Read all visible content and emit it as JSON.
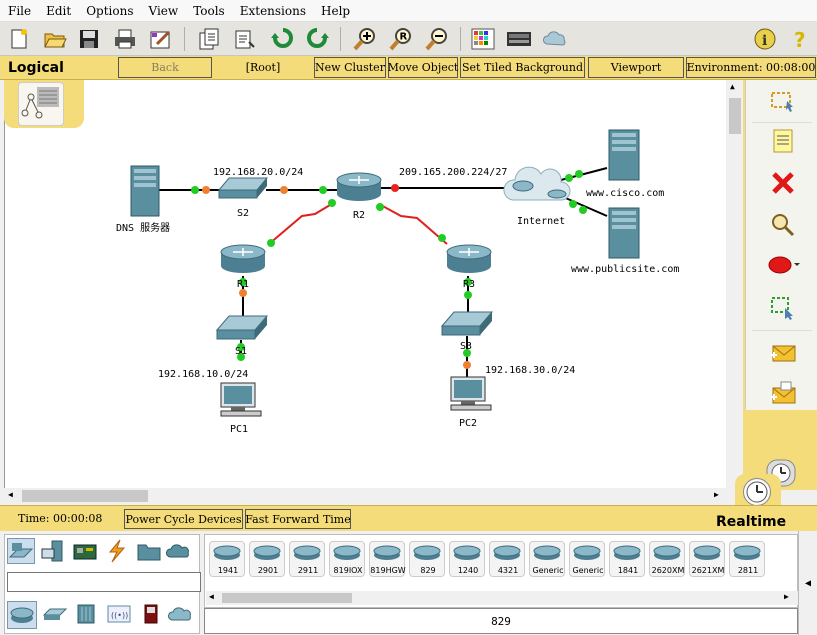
{
  "menu": [
    "File",
    "Edit",
    "Options",
    "View",
    "Tools",
    "Extensions",
    "Help"
  ],
  "navbar": {
    "title": "Logical",
    "back": "Back",
    "root": "[Root]",
    "new_cluster": "New Cluster",
    "move_object": "Move Object",
    "set_tiled_background": "Set Tiled Background",
    "viewport": "Viewport",
    "environment": "Environment: 00:08:00"
  },
  "topology": {
    "networks": {
      "lan20": "192.168.20.0/24",
      "wan": "209.165.200.224/27",
      "lan10": "192.168.10.0/24",
      "lan30": "192.168.30.0/24"
    },
    "devices": {
      "dns": "DNS 服务器",
      "s2": "S2",
      "r2": "R2",
      "internet": "Internet",
      "cisco": "www.cisco.com",
      "publicsite": "www.publicsite.com",
      "r1": "R1",
      "r3": "R3",
      "s1": "S1",
      "s3": "S3",
      "pc1": "PC1",
      "pc2": "PC2"
    },
    "colors": {
      "link_up": "#22cc22",
      "link_orange": "#f08030",
      "link_down": "#ee2020",
      "serial": "#e02020"
    }
  },
  "status": {
    "time": "Time: 00:00:08",
    "power_cycle": "Power Cycle Devices",
    "fast_forward": "Fast Forward Time",
    "mode": "Realtime"
  },
  "device_models": [
    "1941",
    "2901",
    "2911",
    "819IOX",
    "819HGW",
    "829",
    "1240",
    "4321",
    "Generic",
    "Generic",
    "1841",
    "2620XM",
    "2621XM",
    "2811"
  ],
  "selected_model": "829",
  "colors": {
    "accent": "#f3dc79",
    "toolbar": "#e6e4de"
  }
}
